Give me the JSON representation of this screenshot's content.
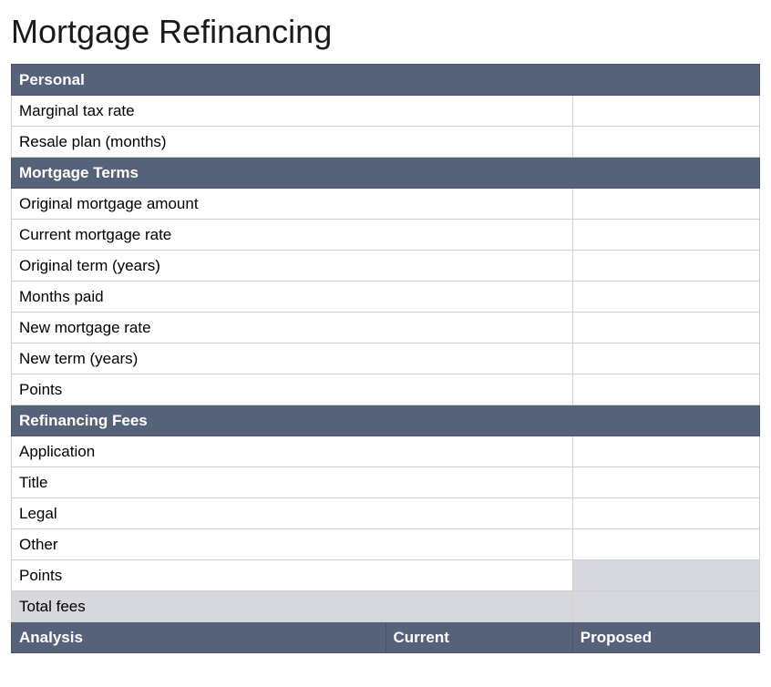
{
  "title": "Mortgage Refinancing",
  "sections": {
    "personal": {
      "header": "Personal",
      "rows": [
        {
          "label": "Marginal tax rate",
          "value": ""
        },
        {
          "label": "Resale plan (months)",
          "value": ""
        }
      ]
    },
    "mortgage_terms": {
      "header": "Mortgage Terms",
      "rows": [
        {
          "label": "Original mortgage amount",
          "value": ""
        },
        {
          "label": "Current mortgage rate",
          "value": ""
        },
        {
          "label": "Original term (years)",
          "value": ""
        },
        {
          "label": "Months paid",
          "value": ""
        },
        {
          "label": "New mortgage rate",
          "value": ""
        },
        {
          "label": "New term (years)",
          "value": ""
        },
        {
          "label": "Points",
          "value": ""
        }
      ]
    },
    "refinancing_fees": {
      "header": "Refinancing Fees",
      "rows": [
        {
          "label": "Application",
          "value": ""
        },
        {
          "label": "Title",
          "value": ""
        },
        {
          "label": "Legal",
          "value": ""
        },
        {
          "label": "Other",
          "value": ""
        },
        {
          "label": "Points",
          "value": ""
        },
        {
          "label": "Total fees",
          "value": ""
        }
      ]
    },
    "analysis": {
      "header": "Analysis",
      "col1": "Current",
      "col2": "Proposed"
    }
  }
}
